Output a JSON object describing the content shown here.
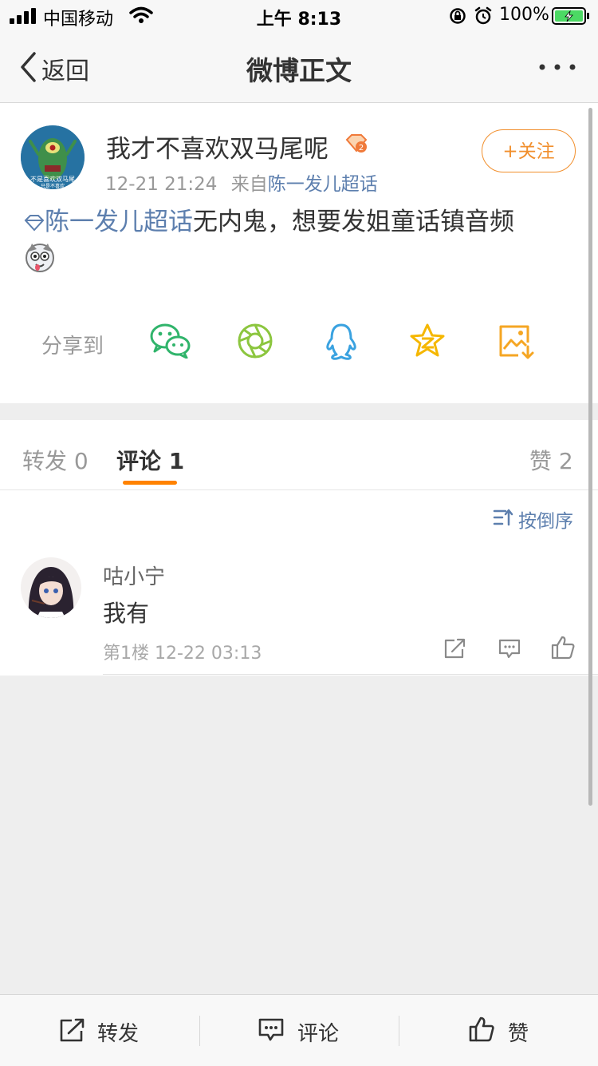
{
  "status_bar": {
    "carrier": "中国移动",
    "time": "上午 8:13",
    "battery_percent": "100%"
  },
  "nav": {
    "back_label": "返回",
    "title": "微博正文"
  },
  "post": {
    "username": "我才不喜欢双马尾呢",
    "timestamp": "12-21 21:24",
    "source_prefix": "来自",
    "source": "陈一发儿超话",
    "follow_label": "+关注",
    "topic": "陈一发儿超话",
    "text": "无内鬼，想要发姐童话镇音频",
    "share_label": "分享到",
    "share_targets": [
      "wechat-icon",
      "moments-icon",
      "qq-icon",
      "qzone-icon",
      "save-image-icon"
    ],
    "avatar_text": [
      "不是喜欢双马尾",
      "只是不喜欢"
    ]
  },
  "tabs": {
    "repost": "转发 0",
    "comment": "评论 1",
    "like": "赞 2"
  },
  "comments": {
    "sort_label": "按倒序",
    "items": [
      {
        "name": "咕小宁",
        "text": "我有",
        "meta": "第1楼 12-22 03:13"
      }
    ]
  },
  "bottom_bar": {
    "repost_label": "转发",
    "comment_label": "评论",
    "like_label": "赞"
  },
  "colors": {
    "accent": "#ff8200",
    "link": "#5d7fae",
    "follow": "#f18f2d"
  }
}
